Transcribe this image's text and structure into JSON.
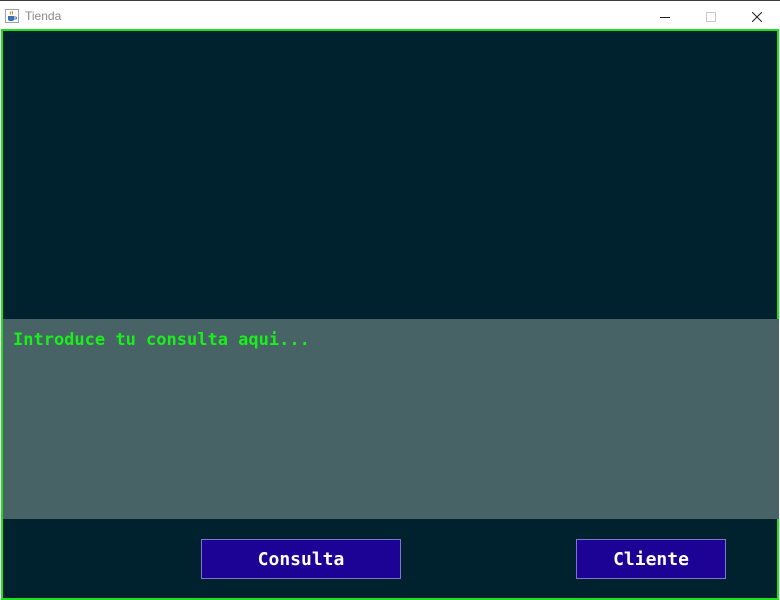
{
  "window": {
    "title": "Tienda",
    "app_icon": "java-cup-icon",
    "controls": {
      "minimize_icon": "minimize-icon",
      "maximize_icon": "maximize-icon",
      "close_icon": "close-icon"
    }
  },
  "output": {
    "text": ""
  },
  "query": {
    "placeholder": "Introduce tu consulta aqui...",
    "value": ""
  },
  "buttons": {
    "consulta_label": "Consulta",
    "cliente_label": "Cliente"
  },
  "colors": {
    "border_accent": "#1fe01f",
    "background_dark": "#00222f",
    "query_background": "#476366",
    "query_text": "#19f019",
    "button_background": "#1c0295",
    "button_text": "#ffffff"
  }
}
